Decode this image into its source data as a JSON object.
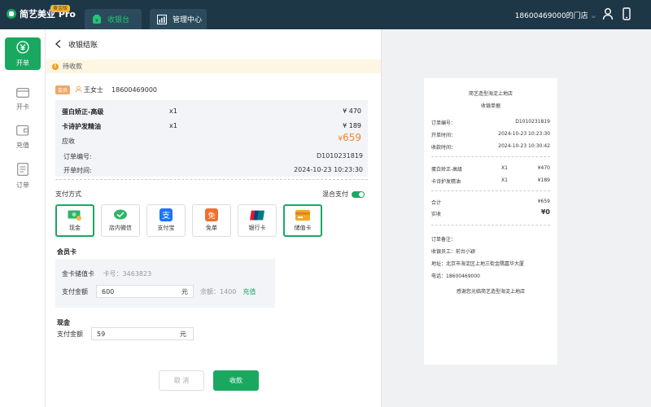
{
  "app": {
    "logo_text": "简艺美业 Pro",
    "badge": "黄金版",
    "nav": {
      "cashier": "收银台",
      "management": "管理中心"
    },
    "store": "18600469000的门店"
  },
  "sidebar": {
    "items": [
      {
        "label": "开单",
        "icon": "yuan-icon",
        "active": true
      },
      {
        "label": "开卡",
        "icon": "card-icon"
      },
      {
        "label": "充值",
        "icon": "wallet-icon"
      },
      {
        "label": "订单",
        "icon": "order-icon"
      }
    ]
  },
  "checkout": {
    "title": "收银结账",
    "status": "待收款",
    "member": {
      "tag": "会员",
      "name": "王女士",
      "phone": "18600469000"
    },
    "items": [
      {
        "name": "蛋白矫正-高级",
        "qty": "x1",
        "price": "¥ 470"
      },
      {
        "name": "卡诗护发精油",
        "qty": "x1",
        "price": "¥ 189"
      }
    ],
    "receivable_label": "应收",
    "receivable_currency": "¥",
    "receivable_amount": "659",
    "order_no_label": "订单编号:",
    "order_no": "D1010231819",
    "open_time_label": "开单时间:",
    "open_time": "2024-10-23 10:23:30",
    "pay_title": "支付方式",
    "mix_label": "混合支付",
    "pay_methods": [
      {
        "label": "现金",
        "icon": "cash-icon",
        "selected": true
      },
      {
        "label": "店内微信",
        "icon": "wechat-icon"
      },
      {
        "label": "支付宝",
        "icon": "alipay-icon"
      },
      {
        "label": "免单",
        "icon": "free-icon"
      },
      {
        "label": "银行卡",
        "icon": "unionpay-icon"
      },
      {
        "label": "储值卡",
        "icon": "stored-card-icon",
        "selected": true
      }
    ],
    "member_card": {
      "section": "会员卡",
      "card_type": "金卡储值卡",
      "card_no": "卡号：3463823",
      "pay_label": "支付金额",
      "pay_amount": "600",
      "unit": "元",
      "balance": "余额：1400",
      "recharge": "充值"
    },
    "cash": {
      "section": "现金",
      "pay_label": "支付金额",
      "pay_amount": "59",
      "unit": "元"
    },
    "cancel": "取 消",
    "submit": "收款"
  },
  "receipt": {
    "store": "简艺造型海淀上地店",
    "title": "收银单据",
    "order_no_label": "订单编号：",
    "order_no": "D1010231819",
    "open_time_label": "开单时间：",
    "open_time": "2024-10-23 10:23:30",
    "pay_time_label": "收款时间：",
    "pay_time": "2024-10-23 10:30:42",
    "items": [
      {
        "name": "蛋白矫正-高级",
        "qty": "X1",
        "price": "¥470"
      },
      {
        "name": "卡诗护发精油",
        "qty": "X1",
        "price": "¥189"
      }
    ],
    "total_label": "合计",
    "total": "¥659",
    "paid_label": "实收",
    "paid": "¥0",
    "remark_label": "订单备注：",
    "cashier": "收银员工：前台小颖",
    "address": "地址：北京市海淀区上地三街金隅嘉华大厦",
    "phone": "电话：18600469000",
    "thanks": "感谢您光临简艺造型海淀上地店"
  },
  "colors": {
    "brand": "#1aa861",
    "topbar": "#1e3747",
    "accent": "#f0862e"
  }
}
